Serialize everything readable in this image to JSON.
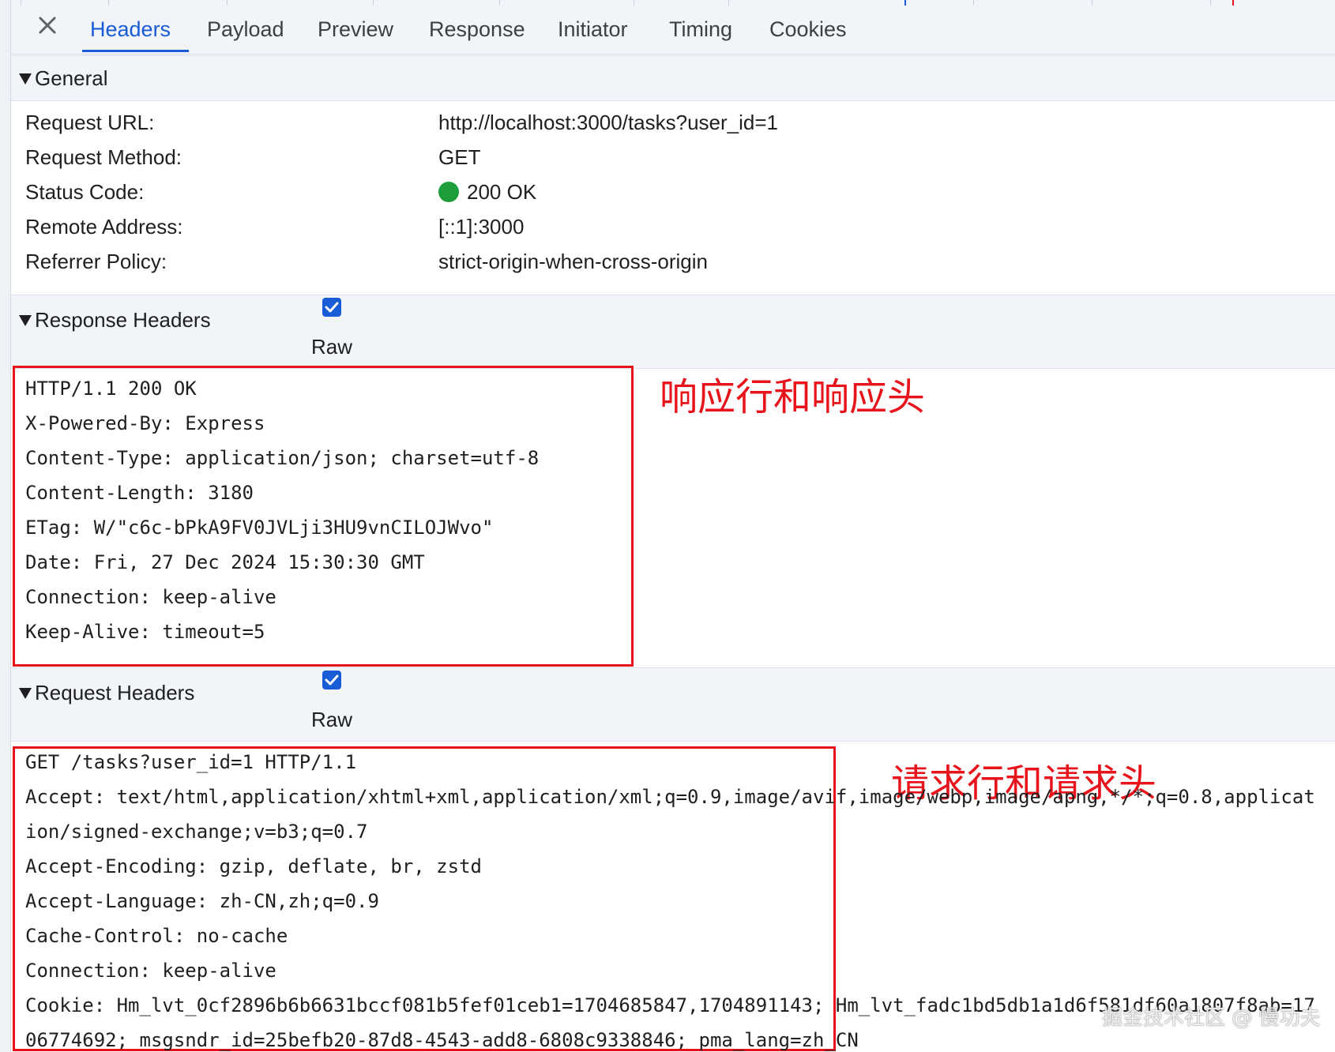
{
  "tabs": {
    "close_symbol": "×",
    "items": [
      {
        "label": "Headers",
        "active": true
      },
      {
        "label": "Payload"
      },
      {
        "label": "Preview"
      },
      {
        "label": "Response"
      },
      {
        "label": "Initiator"
      },
      {
        "label": "Timing"
      },
      {
        "label": "Cookies"
      }
    ]
  },
  "general": {
    "title": "General",
    "rows": [
      {
        "label": "Request URL:",
        "value": "http://localhost:3000/tasks?user_id=1"
      },
      {
        "label": "Request Method:",
        "value": "GET"
      },
      {
        "label": "Status Code:",
        "value": "200 OK",
        "status_color": "#1e9e3a"
      },
      {
        "label": "Remote Address:",
        "value": "[::1]:3000"
      },
      {
        "label": "Referrer Policy:",
        "value": "strict-origin-when-cross-origin"
      }
    ]
  },
  "response_headers": {
    "title": "Response Headers",
    "raw_label": "Raw",
    "raw_checked": true,
    "lines": [
      "HTTP/1.1 200 OK",
      "X-Powered-By: Express",
      "Content-Type: application/json; charset=utf-8",
      "Content-Length: 3180",
      "ETag: W/\"c6c-bPkA9FV0JVLji3HU9vnCILOJWvo\"",
      "Date: Fri, 27 Dec 2024 15:30:30 GMT",
      "Connection: keep-alive",
      "Keep-Alive: timeout=5"
    ],
    "annotation": "响应行和响应头"
  },
  "request_headers": {
    "title": "Request Headers",
    "raw_label": "Raw",
    "raw_checked": true,
    "lines": [
      "GET /tasks?user_id=1 HTTP/1.1",
      "Accept: text/html,application/xhtml+xml,application/xml;q=0.9,image/avif,image/webp,image/apng,*/*;q=0.8,applicat",
      "ion/signed-exchange;v=b3;q=0.7",
      "Accept-Encoding: gzip, deflate, br, zstd",
      "Accept-Language: zh-CN,zh;q=0.9",
      "Cache-Control: no-cache",
      "Connection: keep-alive",
      "Cookie: Hm_lvt_0cf2896b6b6631bccf081b5fef01ceb1=1704685847,1704891143; Hm_lvt_fadc1bd5db1a1d6f581df60a1807f8ab=17",
      "06774692; msgsndr_id=25befb20-87d8-4543-add8-6808c9338846; pma_lang=zh_CN"
    ],
    "annotation": "请求行和请求头"
  },
  "watermark": "掘金技术社区 @ 慢功夫",
  "colors": {
    "accent": "#1a5bd6",
    "annotation_red": "#e8141b",
    "status_green": "#1e9e3a",
    "header_bg": "#f1f4f9"
  }
}
